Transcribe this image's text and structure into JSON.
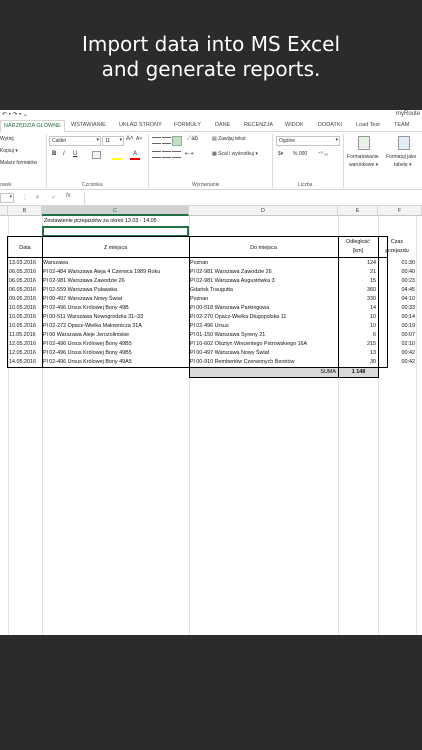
{
  "banner": {
    "line1": "Import data into MS Excel",
    "line2": "and generate reports."
  },
  "title_bar": {
    "quick_access": "↶ • ↷ • ⌄",
    "file_name": "myRoute"
  },
  "ribbon_tabs": [
    "NARZĘDZIA GŁÓWNE",
    "WSTAWIANIE",
    "UKŁAD STRONY",
    "FORMUŁY",
    "DANE",
    "RECENZJA",
    "WIDOK",
    "DODATKI",
    "Load Test",
    "TEAM"
  ],
  "ribbon": {
    "cut": "Wytnij",
    "copy": "Kopiuj ▾",
    "format_painter": "Malarz formatów",
    "clipboard_group": "owek",
    "font_name": "Calibri",
    "font_size": "11",
    "bold": "B",
    "italic": "I",
    "underline": "U",
    "font_group": "Czcionka",
    "wrap_text": "Zawijaj tekst",
    "merge_center": "Scal i wyśrodkuj",
    "alignment_group": "Wyrównanie",
    "number_format": "Ogólne",
    "number_group": "Liczba",
    "percent": "% 000",
    "cond_format": "Formatowanie",
    "cond_format2": "warunkowe ▾",
    "format_table": "Formatuj jako",
    "format_table2": "tabelę ▾",
    "font_grow": "A˄",
    "font_shrink": "A˅"
  },
  "formula_bar": {
    "name_box": "",
    "fx": "fx",
    "cancel": "✕",
    "enter": "✓",
    "value": ""
  },
  "columns": [
    "B",
    "C",
    "D",
    "E",
    "F"
  ],
  "sheet": {
    "summary_title": "Zestawienie przejazdów za okres 13.03 - 14.05",
    "headers": {
      "date": "Data",
      "from": "Z miejsca",
      "to": "Do miejsca",
      "distance1": "Odległość",
      "distance2": "[km]",
      "time1": "Czas",
      "time2": "przejazdu"
    },
    "rows": [
      {
        "date": "13.03.2016",
        "from": "Warszawa",
        "to": "Poznan",
        "km": "124",
        "time": "01:30"
      },
      {
        "date": "06.05.2016",
        "from": "Pl 02-484 Warszawa Aleja 4 Czerwca 1989 Roku",
        "to": "Pl 02-981 Warszawa Zawodzie 26",
        "km": "21",
        "time": "00:40"
      },
      {
        "date": "06.05.2016",
        "from": "Pl 02-981 Warszawa Zawodzie 26",
        "to": "Pl 02-981 Warszawa Augustówka 3",
        "km": "15",
        "time": "00:23"
      },
      {
        "date": "06.05.2016",
        "from": "Pl 02-559 Warszawa Puławska",
        "to": "Gdańsk Traugutta",
        "km": "360",
        "time": "04:45"
      },
      {
        "date": "09.05.2016",
        "from": "Pl 00-497 Warszawa Nowy Świat",
        "to": "Poznan",
        "km": "330",
        "time": "04:10"
      },
      {
        "date": "10.05.2016",
        "from": "Pl 02-496 Ursus Królowej Bony 49B",
        "to": "Pl 00-518 Warszawa Parkingowa",
        "km": "14",
        "time": "00:33"
      },
      {
        "date": "10.05.2016",
        "from": "Pl 00-511 Warszawa Nowogrodzka 31–33",
        "to": "Pl 02-270 Opacz-Wielka Długopolska 11",
        "km": "10",
        "time": "00:14"
      },
      {
        "date": "10.05.2016",
        "from": "Pl 02-272 Opacz-Wielka Malownicza 31A",
        "to": "Pl 02-496 Ursus",
        "km": "10",
        "time": "00:19"
      },
      {
        "date": "11.05.2016",
        "from": "Pl 00 Warszawa Aleje Jerozolimskie",
        "to": "Pl 01-150 Warszawa Syreny 21",
        "km": "6",
        "time": "00:07"
      },
      {
        "date": "12.05.2016",
        "from": "Pl 02-496 Ursus Królowej Bony 49B5",
        "to": "Pl 10-602 Olsztyn Wincentego Pstrowskiego 16A",
        "km": "215",
        "time": "02:10"
      },
      {
        "date": "12.05.2016",
        "from": "Pl 02-496 Ursus Królowej Bony 49B5",
        "to": "Pl 00-497 Warszawa Nowy Świat",
        "km": "13",
        "time": "00:42"
      },
      {
        "date": "14.05.2016",
        "from": "Pl 02-496 Ursus Królowej Bony 49A5",
        "to": "Pl 00-910 Rembertów Czerwonych Beretów",
        "km": "30",
        "time": "00:42"
      }
    ],
    "sum_label": "SUMA",
    "sum_value": "1 148"
  },
  "colors": {
    "excel_green": "#217346",
    "background": "#2b2b2b"
  }
}
